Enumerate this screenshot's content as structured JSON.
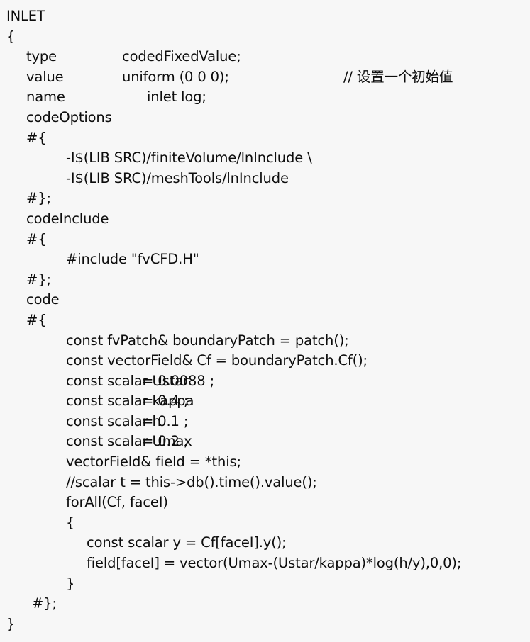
{
  "document": {
    "title": "INLET",
    "background_color": "#f7f7f7",
    "text_color": "#0d0d0d"
  },
  "code": {
    "block_name": "INLET",
    "open_brace": "{",
    "close_brace": "}",
    "entries": {
      "type_key": "type",
      "type_value": "codedFixedValue;",
      "value_key": "value",
      "value_value": "uniform (0 0 0);",
      "value_comment": "// 设置一个初始值",
      "name_key": "name",
      "name_value": "inlet log;",
      "code_options_key": "codeOptions",
      "code_include_key": "codeInclude",
      "code_key": "code"
    },
    "delimiters": {
      "open": "#{",
      "close": "#};"
    },
    "code_options_lines": [
      "-I$(LIB SRC)/finiteVolume/lnInclude \\",
      "-I$(LIB SRC)/meshTools/lnInclude"
    ],
    "code_include_lines": [
      "#include \"fvCFD.H\""
    ],
    "code_body": {
      "line_patch": "const fvPatch& boundaryPatch = patch();",
      "line_cf": "const vectorField& Cf = boundaryPatch.Cf();",
      "scalars": [
        {
          "decl": "const scalar Ustar",
          "assign": "= 0.0088 ;"
        },
        {
          "decl": "const scalar kappa",
          "assign": "= 0.4 ;"
        },
        {
          "decl": "const scalar h",
          "assign": "= 0.1 ;"
        },
        {
          "decl": "const scalar Umax",
          "assign": "= 0.2 ;"
        }
      ],
      "line_field": "vectorField& field = *this;",
      "line_commented_time": "//scalar t = this->db().time().value();",
      "line_forall": "forAll(Cf, faceI)",
      "loop_open": "{",
      "loop_lines": [
        "const scalar y = Cf[faceI].y();",
        "field[faceI] = vector(Umax-(Ustar/kappa)*log(h/y),0,0);"
      ],
      "loop_close": "}"
    }
  }
}
